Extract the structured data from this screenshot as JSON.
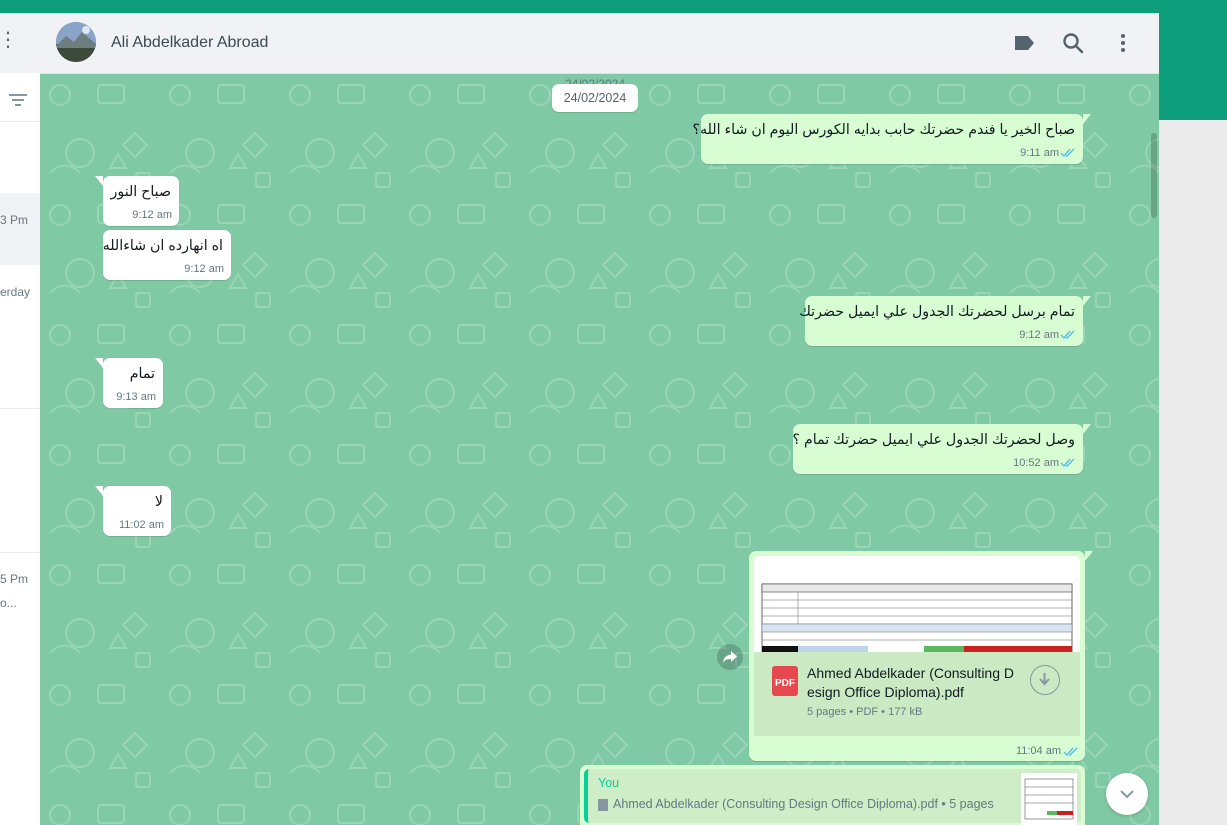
{
  "colors": {
    "accent": "#0d9e7c",
    "outgoing": "#d9fdd3",
    "incoming": "#ffffff",
    "wallpaper": "#7fc9a4",
    "tick_read": "#53bdeb"
  },
  "sidebar": {
    "rows": [
      {
        "label": "3 Pm"
      },
      {
        "label": "erday"
      },
      {
        "label": "5 Pm"
      },
      {
        "label": "o..."
      }
    ]
  },
  "chat": {
    "contact_name": "Ali Abdelkader Abroad",
    "icons": {
      "label": "label-icon",
      "search": "search-icon",
      "menu": "menu-icon"
    },
    "date_ghost": "24/02/2024",
    "date_divider": "24/02/2024",
    "messages": [
      {
        "dir": "out",
        "text": "صباح الخير يا فندم حضرتك حابب بدايه الكورس اليوم ان شاء الله؟",
        "time": "9:11 am"
      },
      {
        "dir": "in",
        "text": "صباح النور",
        "time": "9:12 am"
      },
      {
        "dir": "in",
        "text": "اه انهارده ان شاءالله",
        "time": "9:12 am"
      },
      {
        "dir": "out",
        "text": "تمام برسل لحضرتك الجدول علي ايميل حضرتك",
        "time": "9:12 am"
      },
      {
        "dir": "in",
        "text": "تمام",
        "time": "9:13 am"
      },
      {
        "dir": "out",
        "text": "وصل لحضرتك الجدول علي ايميل حضرتك تمام ؟",
        "time": "10:52 am"
      },
      {
        "dir": "in",
        "text": "لا",
        "time": "11:02 am"
      }
    ],
    "document": {
      "icon_label": "PDF",
      "file_name": "Ahmed Abdelkader (Consulting Design Office Diploma).pdf",
      "meta": "5 pages • PDF • 177 kB",
      "time": "11:04 am"
    },
    "reply": {
      "author": "You",
      "text": "Ahmed Abdelkader (Consulting Design Office Diploma).pdf • 5 pages"
    }
  }
}
